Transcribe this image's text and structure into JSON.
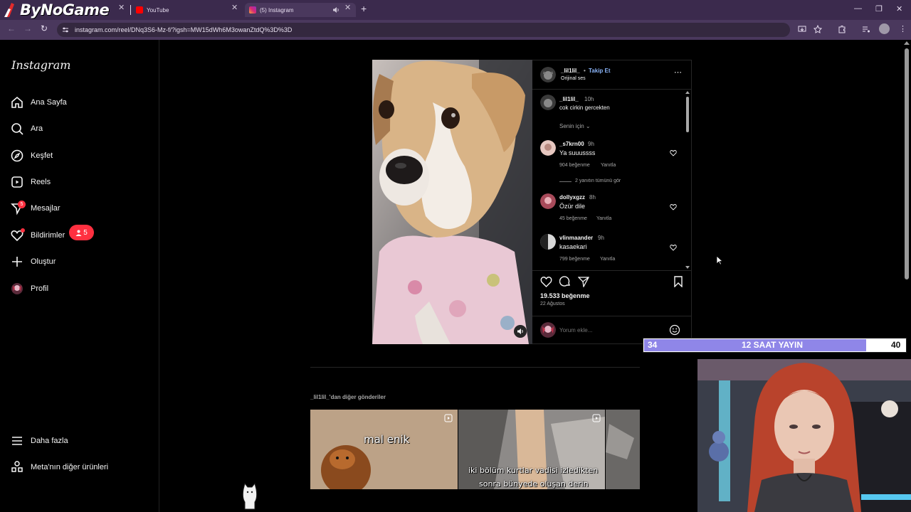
{
  "browser": {
    "brand_name": "ByNoGame",
    "tabs": [
      {
        "title": "YouTube",
        "active": false
      },
      {
        "title": "(5) Instagram",
        "active": true
      }
    ],
    "new_tab_symbol": "+",
    "url": "instagram.com/reel/DNq3S6-Mz-f/?igsh=MW15dWh6M3owanZtdQ%3D%3D",
    "icons": [
      "back-icon",
      "forward-icon",
      "reload-icon",
      "site-info-icon",
      "install-icon",
      "bookmark-star-icon",
      "extensions-icon",
      "media-icon",
      "profile-icon",
      "menu-icon"
    ]
  },
  "sidebar": {
    "logo": "Instagram",
    "items": [
      {
        "label": "Ana Sayfa",
        "icon": "home-icon"
      },
      {
        "label": "Ara",
        "icon": "search-icon"
      },
      {
        "label": "Keşfet",
        "icon": "explore-icon"
      },
      {
        "label": "Reels",
        "icon": "reels-icon"
      },
      {
        "label": "Mesajlar",
        "icon": "messages-icon",
        "badge": "5"
      },
      {
        "label": "Bildirimler",
        "icon": "heart-icon",
        "pill": "5"
      },
      {
        "label": "Oluştur",
        "icon": "plus-icon"
      },
      {
        "label": "Profil",
        "icon": "avatar-icon"
      }
    ],
    "bottom_items": [
      {
        "label": "Daha fazla",
        "icon": "hamburger-icon"
      },
      {
        "label": "Meta'nın diğer ürünleri",
        "icon": "meta-grid-icon"
      }
    ]
  },
  "post": {
    "author": "_lil1lil_",
    "separator": "•",
    "follow_label": "Takip Et",
    "audio": "Orijinal ses",
    "caption": {
      "user": "_lil1lil_",
      "time": "10h",
      "text": "cok cirkin gercekten"
    },
    "sort_label": "Senin için",
    "comments": [
      {
        "user": "_s7krn00",
        "time": "9h",
        "text": "Ya suuussss",
        "likes": "904 beğenme",
        "reply": "Yanıtla",
        "view_replies": "2 yanıtın tümünü gör"
      },
      {
        "user": "dollyxgzz",
        "time": "8h",
        "text": "Özür dile",
        "likes": "45 beğenme",
        "reply": "Yanıtla"
      },
      {
        "user": "vlinmaander",
        "time": "9h",
        "text": "kasaekari",
        "likes": "799 beğenme",
        "reply": "Yanıtla"
      }
    ],
    "like_count": "19.533 beğenme",
    "date": "22 Ağustos",
    "comment_placeholder": "Yorum ekle...",
    "more_posts_title": "_lil1lil_'dan diğer gönderiler",
    "thumbnails": [
      {
        "caption": "mal enik"
      },
      {
        "caption_line1": "iki bölüm kurtlar vadisi izledikten",
        "caption_line2": "sonra bünyede oluşan derin"
      },
      {
        "caption": ""
      }
    ]
  },
  "overlay": {
    "timer_left": "34",
    "timer_label": "12 SAAT YAYIN",
    "timer_right": "40"
  },
  "colors": {
    "accent_link": "#8ab4f8",
    "notification_red": "#ff3040",
    "timer_purple": "#8f86e8",
    "chrome_purple": "#3b2a4d"
  }
}
